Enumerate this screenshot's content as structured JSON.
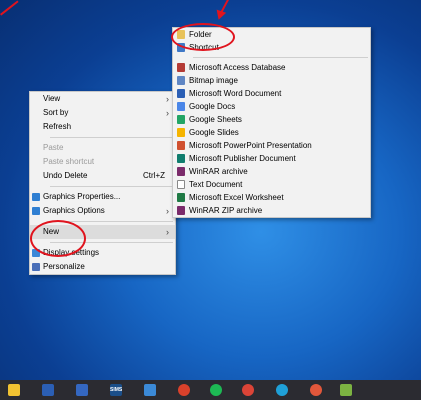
{
  "context_menu": {
    "items": [
      {
        "label": "View",
        "submenu": true,
        "disabled": false
      },
      {
        "label": "Sort by",
        "submenu": true,
        "disabled": false
      },
      {
        "label": "Refresh",
        "submenu": false,
        "disabled": false
      },
      {
        "label": "Paste",
        "submenu": false,
        "disabled": true
      },
      {
        "label": "Paste shortcut",
        "submenu": false,
        "disabled": true
      },
      {
        "label": "Undo Delete",
        "shortcut": "Ctrl+Z",
        "disabled": false
      },
      {
        "label": "Graphics Properties...",
        "icon": "graphics-icon"
      },
      {
        "label": "Graphics Options",
        "icon": "graphics-icon",
        "submenu": true
      },
      {
        "label": "New",
        "submenu": true,
        "active": true
      },
      {
        "label": "Display settings",
        "icon": "display-icon"
      },
      {
        "label": "Personalize",
        "icon": "personalize-icon"
      }
    ]
  },
  "new_submenu": {
    "items": [
      {
        "label": "Folder",
        "icon": "folder-icon"
      },
      {
        "label": "Shortcut",
        "icon": "shortcut-icon"
      },
      {
        "label": "Microsoft Access Database",
        "icon": "access-icon"
      },
      {
        "label": "Bitmap image",
        "icon": "bitmap-icon"
      },
      {
        "label": "Microsoft Word Document",
        "icon": "word-icon"
      },
      {
        "label": "Google Docs",
        "icon": "google-docs-icon"
      },
      {
        "label": "Google Sheets",
        "icon": "google-sheets-icon"
      },
      {
        "label": "Google Slides",
        "icon": "google-slides-icon"
      },
      {
        "label": "Microsoft PowerPoint Presentation",
        "icon": "powerpoint-icon"
      },
      {
        "label": "Microsoft Publisher Document",
        "icon": "publisher-icon"
      },
      {
        "label": "WinRAR archive",
        "icon": "winrar-icon"
      },
      {
        "label": "Text Document",
        "icon": "text-document-icon"
      },
      {
        "label": "Microsoft Excel Worksheet",
        "icon": "excel-icon"
      },
      {
        "label": "WinRAR ZIP archive",
        "icon": "winrar-zip-icon"
      }
    ]
  },
  "taskbar": {
    "icons": [
      "file-explorer-icon",
      "word-icon",
      "sims-icon",
      "edit-icon",
      "app-icon",
      "spotify-icon",
      "chrome-icon",
      "edge-icon",
      "chrome-icon-2",
      "android-studio-icon"
    ],
    "sims_label": "SIMS"
  },
  "colors": {
    "annotation": "#e0141e",
    "menu_bg": "#f2f2f2",
    "taskbar_bg": "#2b2b31"
  }
}
